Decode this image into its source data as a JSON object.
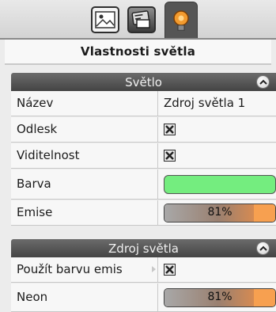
{
  "tabs": [
    {
      "icon": "scene-image-icon",
      "active": false
    },
    {
      "icon": "object-card-icon",
      "active": false
    },
    {
      "icon": "light-bulb-icon",
      "active": true
    }
  ],
  "panel_title": "Vlastnosti světla",
  "sections": [
    {
      "title": "Světlo",
      "rows": [
        {
          "label": "Název",
          "type": "text",
          "value": "Zdroj světla 1"
        },
        {
          "label": "Odlesk",
          "type": "checkbox",
          "checked": true
        },
        {
          "label": "Viditelnost",
          "type": "checkbox",
          "checked": true
        },
        {
          "label": "Barva",
          "type": "color",
          "color": "#74ed7f"
        },
        {
          "label": "Emise",
          "type": "progress",
          "value": 0.81,
          "text": "81%"
        }
      ]
    },
    {
      "title": "Zdroj světla",
      "rows": [
        {
          "label": "Použít barvu emis",
          "type": "checkbox",
          "checked": true
        },
        {
          "label": "Neon",
          "type": "progress",
          "value": 0.81,
          "text": "81%"
        }
      ]
    }
  ],
  "colors": {
    "accent_orange": "#f7a050",
    "light_tab_bulb": "#f29a2e",
    "section_header": "#555555"
  }
}
